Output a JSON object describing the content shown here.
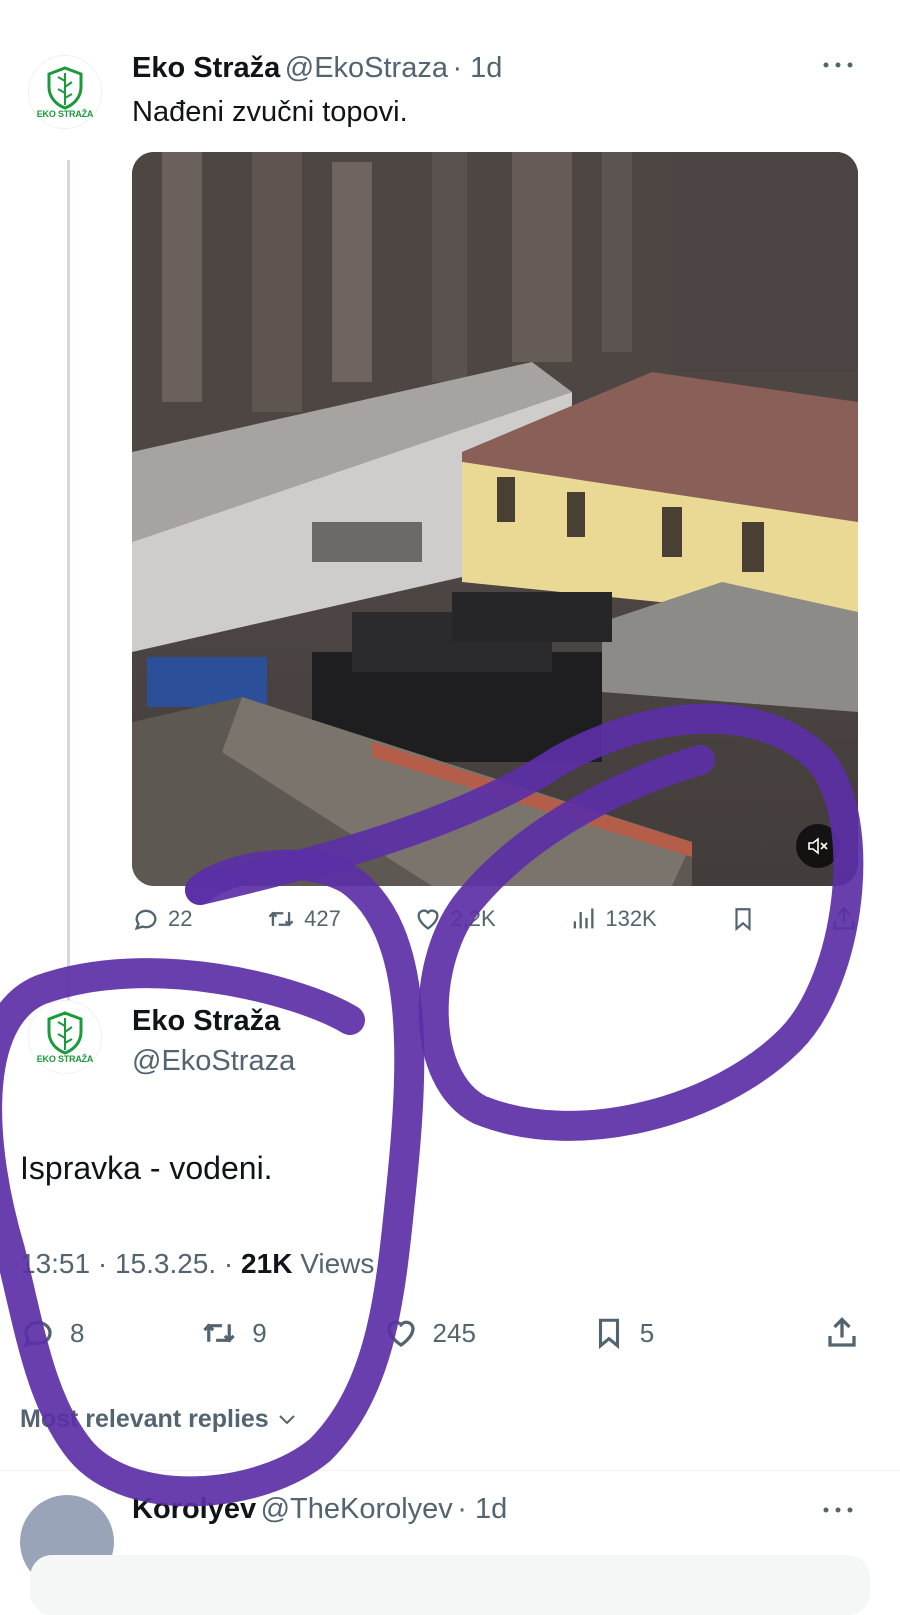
{
  "tweet": {
    "name": "Eko Straža",
    "handle": "@EkoStraza",
    "time": "· 1d",
    "text": "Nađeni zvučni topovi.",
    "logo_text": "EKO STRAŽA",
    "more_icon": "more-dots-icon",
    "actions": {
      "replies": "22",
      "retweets": "427",
      "likes": "2,2K",
      "views": "132K"
    }
  },
  "reply_tweet": {
    "name": "Eko Straža",
    "handle": "@EkoStraza",
    "logo_text": "EKO STRAŽA",
    "text": "Ispravka - vodeni.",
    "timestamp": "13:51 · 15.3.25. · ",
    "views_count": "21K",
    "views_label": " Views",
    "actions": {
      "replies": "8",
      "retweets": "9",
      "likes": "245",
      "bookmarks": "5"
    }
  },
  "replies_sort": {
    "label": "Most relevant replies"
  },
  "next_reply": {
    "name": "Korolyev",
    "handle": "@TheKorolyev",
    "time": "· 1d"
  },
  "colors": {
    "annotation": "#5b2fa6",
    "brand_green": "#1a9a3a",
    "muted": "#536471"
  }
}
